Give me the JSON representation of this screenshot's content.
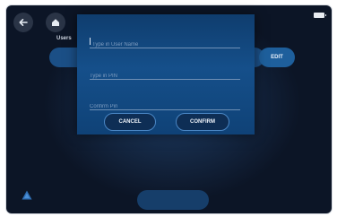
{
  "header": {
    "back_icon": "arrow-left-icon",
    "home_icon": "home-icon",
    "battery_icon": "battery-icon"
  },
  "users": {
    "label": "Users",
    "edit_label": "EDIT"
  },
  "modal": {
    "name_placeholder": "Type in User Name",
    "pin_placeholder": "Type in PIN",
    "confirm_pin_placeholder": "Confirm Pin",
    "cancel_label": "CANCEL",
    "confirm_label": "CONFIRM"
  },
  "colors": {
    "background": "#0c1526",
    "modal": "#154f8a",
    "accent": "#1e5f9c"
  }
}
